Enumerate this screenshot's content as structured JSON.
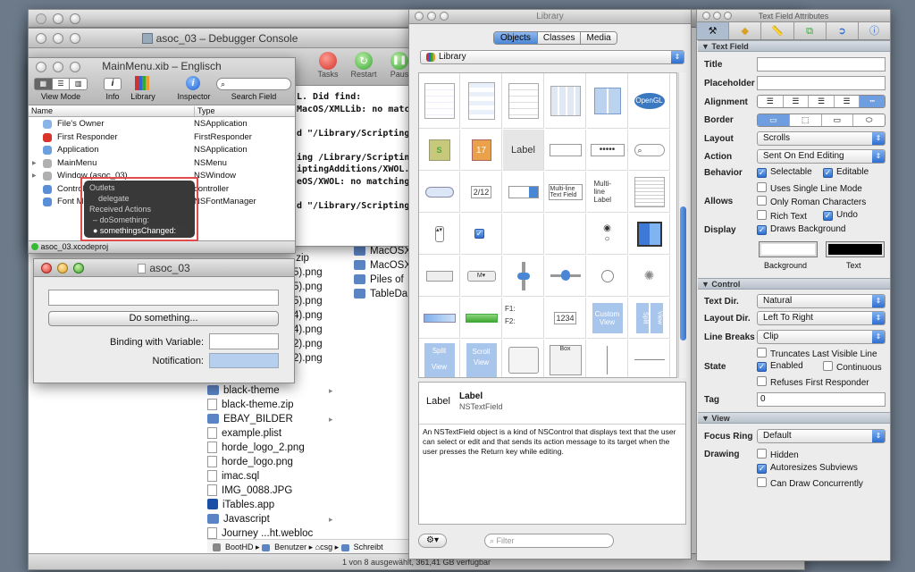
{
  "finder_back": {
    "items": [
      "MacOSX",
      "MacOSX",
      "Piles of",
      "TableDa"
    ],
    "left_items": [
      ".zip",
      "5).png",
      "5).png",
      "5).png",
      "4).png",
      "4).png",
      "2).png",
      "2).png"
    ],
    "files": [
      {
        "name": "black-theme",
        "kind": "folder",
        "arrow": "▸"
      },
      {
        "name": "black-theme.zip",
        "kind": "file",
        "arrow": ""
      },
      {
        "name": "EBAY_BILDER",
        "kind": "folder",
        "arrow": "▸"
      },
      {
        "name": "example.plist",
        "kind": "file",
        "arrow": ""
      },
      {
        "name": "horde_logo_2.png",
        "kind": "file",
        "arrow": ""
      },
      {
        "name": "horde_logo.png",
        "kind": "file",
        "arrow": ""
      },
      {
        "name": "imac.sql",
        "kind": "file",
        "arrow": ""
      },
      {
        "name": "IMG_0088.JPG",
        "kind": "file",
        "arrow": ""
      },
      {
        "name": "iTables.app",
        "kind": "app",
        "arrow": ""
      },
      {
        "name": "Javascript",
        "kind": "folder",
        "arrow": "▸"
      },
      {
        "name": "Journey ...ht.webloc",
        "kind": "file",
        "arrow": ""
      }
    ],
    "path": [
      "BootHD",
      "Benutzer",
      "csg",
      "Schreibt"
    ],
    "status": "1 von 8 ausgewählt, 361,41 GB verfügbar"
  },
  "debugger": {
    "title": "asoc_03 – Debugger Console",
    "toolbar": [
      "Tasks",
      "Restart",
      "Paus"
    ],
    "log": [
      "L. Did find:",
      "MacOS/XMLLib: no matching",
      "",
      "d \"/Library/ScriptingAd",
      "",
      "ing /Library/ScriptingA",
      "iptingAdditions/XWOL.osa",
      "eOS/XWOL: no matching ar",
      "",
      "d \"/Library/ScriptingAd"
    ]
  },
  "mainmenu": {
    "title": "MainMenu.xib – Englisch",
    "toolbar": {
      "view_mode": "View Mode",
      "info": "Info",
      "library": "Library",
      "inspector": "Inspector",
      "search": "Search Field"
    },
    "columns": [
      "Name",
      "Type"
    ],
    "rows": [
      {
        "name": "File's Owner",
        "type": "NSApplication",
        "arrow": ""
      },
      {
        "name": "First Responder",
        "type": "FirstResponder",
        "arrow": ""
      },
      {
        "name": "Application",
        "type": "NSApplication",
        "arrow": ""
      },
      {
        "name": "MainMenu",
        "type": "NSMenu",
        "arrow": "▶"
      },
      {
        "name": "Window (asoc_03)",
        "type": "NSWindow",
        "arrow": "▶"
      },
      {
        "name": "Control",
        "type": "controller",
        "arrow": ""
      },
      {
        "name": "Font M",
        "type": "NSFontManager",
        "arrow": ""
      }
    ],
    "status": "asoc_03.xcodeproj",
    "popup": {
      "outlets": "Outlets",
      "delegate": "delegate",
      "received": "Received Actions",
      "action1": "– doSomething:",
      "action2": "● somethingsChanged:"
    }
  },
  "asoc": {
    "title": "asoc_03",
    "button": "Do something...",
    "binding_label": "Binding with Variable:",
    "notification_label": "Notification:"
  },
  "library": {
    "title": "Library",
    "tabs": [
      "Objects",
      "Classes",
      "Media"
    ],
    "dropdown": "Library",
    "cells": {
      "label": "Label",
      "dots": "•••••",
      "stepper_val": "2/12",
      "multi1": "Multi-line Text Field",
      "multi2": "Multi-line Label",
      "opengl": "OpenGL",
      "f1": "F1:",
      "f2": "F2:",
      "num": "1234",
      "custom": "Custom View",
      "split": "Split",
      "view": "View",
      "scroll": "Scroll",
      "box": "Box"
    },
    "detail": {
      "label": "Label",
      "name": "Label",
      "cls": "NSTextField",
      "desc": "An NSTextField object is a kind of NSControl that displays text that the user can select or edit and that sends its action message to its target when the user presses the Return key while editing."
    },
    "filter_placeholder": "Filter"
  },
  "attrs": {
    "title": "Text Field Attributes",
    "text_field_section": "Text Field",
    "labels": {
      "title": "Title",
      "placeholder": "Placeholder",
      "alignment": "Alignment",
      "border": "Border",
      "layout": "Layout",
      "action": "Action",
      "behavior": "Behavior",
      "allows": "Allows",
      "display": "Display"
    },
    "layout": "Scrolls",
    "action": "Sent On End Editing",
    "behavior": {
      "selectable": "Selectable",
      "editable": "Editable",
      "single": "Uses Single Line Mode"
    },
    "allows": {
      "roman": "Only Roman Characters",
      "rich": "Rich Text",
      "undo": "Undo"
    },
    "display": {
      "draws": "Draws Background",
      "background": "Background",
      "text": "Text"
    },
    "control_section": "Control",
    "control_labels": {
      "text_dir": "Text Dir.",
      "layout_dir": "Layout Dir.",
      "line_breaks": "Line Breaks",
      "state": "State",
      "tag": "Tag"
    },
    "text_dir": "Natural",
    "layout_dir": "Left To Right",
    "line_breaks": "Clip",
    "truncates": "Truncates Last Visible Line",
    "enabled": "Enabled",
    "continuous": "Continuous",
    "refuses": "Refuses First Responder",
    "tag_value": "0",
    "view_section": "View",
    "view_labels": {
      "focus": "Focus Ring",
      "drawing": "Drawing"
    },
    "focus": "Default",
    "hidden": "Hidden",
    "autoresizes": "Autoresizes Subviews",
    "concurrent": "Can Draw Concurrently"
  }
}
